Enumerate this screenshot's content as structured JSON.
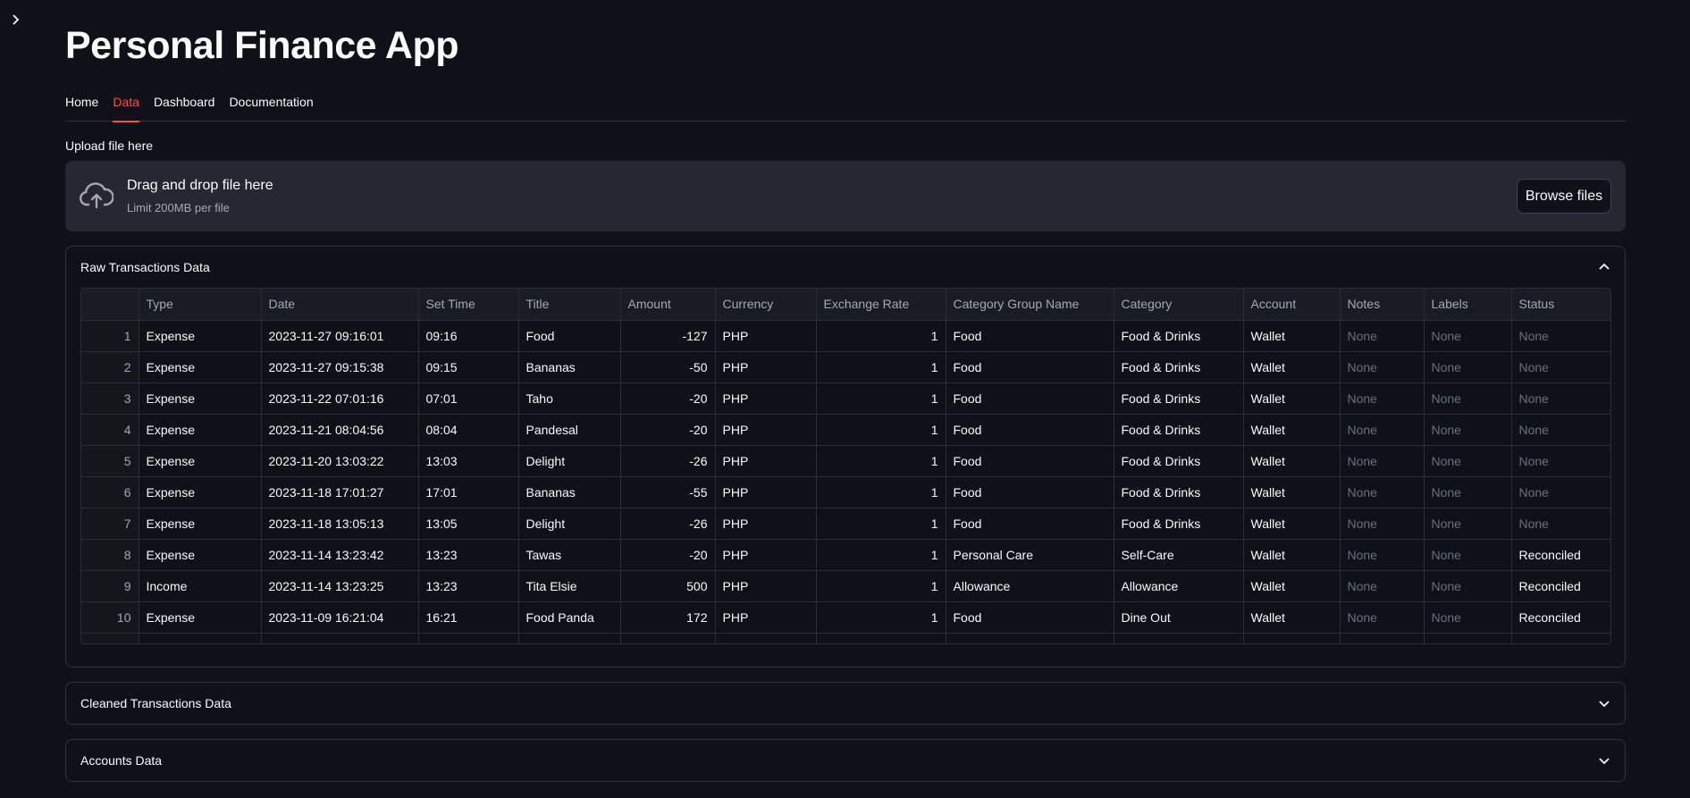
{
  "app": {
    "title": "Personal Finance App"
  },
  "tabs": [
    "Home",
    "Data",
    "Dashboard",
    "Documentation"
  ],
  "active_tab": "Data",
  "uploader": {
    "label": "Upload file here",
    "title": "Drag and drop file here",
    "limit": "Limit 200MB per file",
    "button": "Browse files"
  },
  "expanders": {
    "raw": "Raw Transactions Data",
    "cleaned": "Cleaned Transactions Data",
    "accounts": "Accounts Data"
  },
  "table": {
    "columns": [
      "Type",
      "Date",
      "Set Time",
      "Title",
      "Amount",
      "Currency",
      "Exchange Rate",
      "Category Group Name",
      "Category",
      "Account",
      "Notes",
      "Labels",
      "Status"
    ],
    "rows": [
      [
        "1",
        "Expense",
        "2023-11-27 09:16:01",
        "09:16",
        "Food",
        "-127",
        "PHP",
        "1",
        "Food",
        "Food & Drinks",
        "Wallet",
        "None",
        "None",
        "None"
      ],
      [
        "2",
        "Expense",
        "2023-11-27 09:15:38",
        "09:15",
        "Bananas",
        "-50",
        "PHP",
        "1",
        "Food",
        "Food & Drinks",
        "Wallet",
        "None",
        "None",
        "None"
      ],
      [
        "3",
        "Expense",
        "2023-11-22 07:01:16",
        "07:01",
        "Taho",
        "-20",
        "PHP",
        "1",
        "Food",
        "Food & Drinks",
        "Wallet",
        "None",
        "None",
        "None"
      ],
      [
        "4",
        "Expense",
        "2023-11-21 08:04:56",
        "08:04",
        "Pandesal",
        "-20",
        "PHP",
        "1",
        "Food",
        "Food & Drinks",
        "Wallet",
        "None",
        "None",
        "None"
      ],
      [
        "5",
        "Expense",
        "2023-11-20 13:03:22",
        "13:03",
        "Delight",
        "-26",
        "PHP",
        "1",
        "Food",
        "Food & Drinks",
        "Wallet",
        "None",
        "None",
        "None"
      ],
      [
        "6",
        "Expense",
        "2023-11-18 17:01:27",
        "17:01",
        "Bananas",
        "-55",
        "PHP",
        "1",
        "Food",
        "Food & Drinks",
        "Wallet",
        "None",
        "None",
        "None"
      ],
      [
        "7",
        "Expense",
        "2023-11-18 13:05:13",
        "13:05",
        "Delight",
        "-26",
        "PHP",
        "1",
        "Food",
        "Food & Drinks",
        "Wallet",
        "None",
        "None",
        "None"
      ],
      [
        "8",
        "Expense",
        "2023-11-14 13:23:42",
        "13:23",
        "Tawas",
        "-20",
        "PHP",
        "1",
        "Personal Care",
        "Self-Care",
        "Wallet",
        "None",
        "None",
        "Reconciled"
      ],
      [
        "9",
        "Income",
        "2023-11-14 13:23:25",
        "13:23",
        "Tita Elsie",
        "500",
        "PHP",
        "1",
        "Allowance",
        "Allowance",
        "Wallet",
        "None",
        "None",
        "Reconciled"
      ],
      [
        "10",
        "Expense",
        "2023-11-09 16:21:04",
        "16:21",
        "Food Panda",
        "172",
        "PHP",
        "1",
        "Food",
        "Dine Out",
        "Wallet",
        "None",
        "None",
        "Reconciled"
      ]
    ]
  },
  "colors": {
    "accent": "#ff4b4b",
    "background": "#0e1117",
    "surface": "#262730"
  },
  "icons": {
    "sidebar": "chevron-right-icon",
    "upload": "cloud-upload-icon",
    "collapse": "chevron-up-icon",
    "expand": "chevron-down-icon"
  }
}
